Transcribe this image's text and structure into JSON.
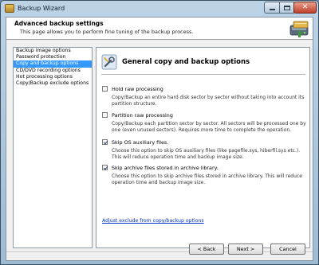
{
  "window": {
    "title": "Backup Wizard",
    "controls": {
      "minimize": "minimize",
      "maximize": "maximize",
      "close": "✕"
    }
  },
  "header": {
    "title": "Advanced backup settings",
    "subtitle": "This page allows you to perform fine tuning of the backup process."
  },
  "sidebar": {
    "items": [
      {
        "label": "Backup image options",
        "selected": false
      },
      {
        "label": "Password protection",
        "selected": false
      },
      {
        "label": "Copy and backup options",
        "selected": true
      },
      {
        "label": "CD/DVD recording options",
        "selected": false
      },
      {
        "label": "Hot processing options",
        "selected": false
      },
      {
        "label": "Copy/Backup exclude options",
        "selected": false
      }
    ]
  },
  "panel": {
    "title": "General copy and backup options",
    "options": [
      {
        "label": "Hold raw processing",
        "checked": false,
        "description": "Copy/Backup an entire hard disk sector by sector without taking into account its partition structure."
      },
      {
        "label": "Partition raw processing",
        "checked": false,
        "description": "Copy/Backup each partition sector by sector. All sectors will be processed one by one (even unused sectors). Requires more time to complete the operation."
      },
      {
        "label": "Skip OS auxiliary files.",
        "checked": true,
        "description": "Choose this option to skip OS auxiliary files (like pagefile.sys, hiberfil.sys etc.). This will reduce operation time and backup image size."
      },
      {
        "label": "Skip archive files stored in archive library.",
        "checked": true,
        "description": "Choose this option to skip archive files stored in archive library. This will reduce operation time and backup image size."
      }
    ],
    "link": "Adjust exclude from copy/backup options"
  },
  "footer": {
    "back": "< Back",
    "next": "Next >",
    "cancel": "Cancel"
  },
  "colors": {
    "selection": "#3399ff",
    "link": "#0033cc",
    "titlebar": "#bcd3e6",
    "close_button": "#c0402a"
  },
  "icons": {
    "app": "backup-wizard-app-icon",
    "header": "hard-drive-backup-icon",
    "panel": "wrench-settings-icon"
  }
}
